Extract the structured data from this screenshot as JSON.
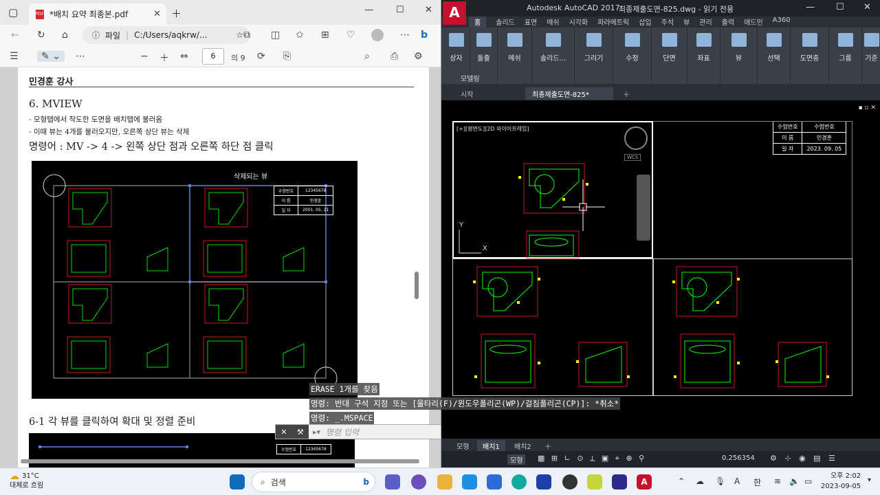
{
  "edge": {
    "tab_title": "*배치 요약 최종본.pdf",
    "address_label": "파일",
    "address_path": "C:/Users/aqkrw/...",
    "page_current": "6",
    "page_total": "의 9"
  },
  "pdf": {
    "author": "민경훈 강사",
    "heading": "6. MVIEW",
    "bullet1": "- 모형탭에서 작도한 도면을 배치탭에 불러옴",
    "bullet2": "- 이때 뷰는 4개를 불러오지만, 오른쪽 상단 뷰는 삭제",
    "command": "명령어 :  MV -> 4 -> 왼쪽 상단 점과 오른쪽 하단 점 클릭",
    "image_caption": "삭제되는 뷰",
    "image_table": [
      [
        "수험번호",
        "12345678"
      ],
      [
        "이 름",
        "민경훈"
      ],
      [
        "일 자",
        "2001. 05. 21"
      ]
    ],
    "subheading": "6-1 각 뷰를 클릭하여 확대 및 정렬 준비",
    "image2_table": [
      [
        "수험번호",
        "12345678"
      ]
    ]
  },
  "acad": {
    "app_title": "Autodesk AutoCAD 2017",
    "file_title": "최종제출도면-825.dwg - 읽기 전용",
    "ribbon_tabs": [
      "홈",
      "솔리드",
      "표면",
      "메쉬",
      "시각화",
      "파라메트릭",
      "삽입",
      "주석",
      "뷰",
      "관리",
      "출력",
      "애드인",
      "A360"
    ],
    "ribbon_buttons": [
      "상자",
      "돌출",
      "메쉬",
      "솔리드...",
      "그리기",
      "수정",
      "단면",
      "좌표",
      "뷰",
      "선택",
      "도면층",
      "그룹",
      "기준"
    ],
    "ribbon_group": "모델링",
    "doc_tabs": [
      "시작",
      "최종제출도면-825*"
    ],
    "viewport_label": "[+][평면도][2D 와이어프레임]",
    "wcs": "WCS",
    "title_block": [
      [
        "수험번호",
        "수험번호"
      ],
      [
        "이 름",
        "민경훈"
      ],
      [
        "일 자",
        "2023. 09. 05"
      ]
    ],
    "layout_tabs": [
      "모형",
      "배치1",
      "배치2"
    ],
    "status_model": "모형",
    "status_scale": "0.256354"
  },
  "command": {
    "line1": "ERASE 1개를 찾음",
    "line2": "명령: 반대 구석 지정 또는 [울타리(F)/윈도우폴리곤(WP)/걸침폴리곤(CP)]: *취소*",
    "line3": "명령:  _.MSPACE",
    "placeholder": "명령 입력"
  },
  "taskbar": {
    "temp": "31°C",
    "weather": "대체로 흐림",
    "search": "검색",
    "ime": "한",
    "lang": "A",
    "time": "오후 2:02",
    "date": "2023-09-05"
  },
  "colors": {
    "autocad_red": "#c8102e",
    "edge_blue": "#0f6cbd",
    "drawing_green": "#00ff00",
    "drawing_red": "#ff2020",
    "drawing_yellow": "#ffff00"
  }
}
